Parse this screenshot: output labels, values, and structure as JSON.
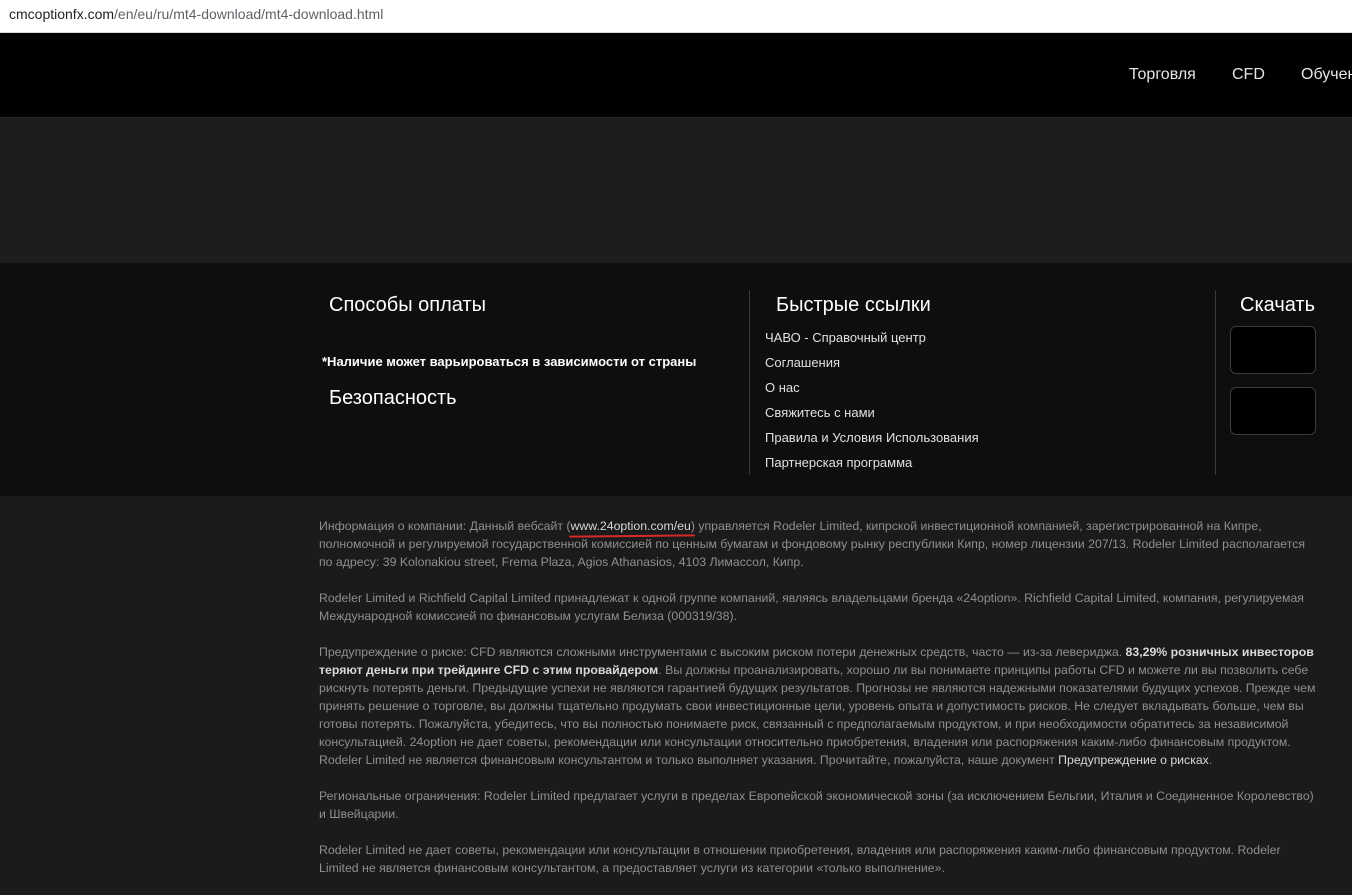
{
  "address_bar": {
    "host": "cmcoptionfx.com",
    "path": "/en/eu/ru/mt4-download/mt4-download.html"
  },
  "nav": {
    "items": [
      "Торговля",
      "CFD",
      "Обучение"
    ]
  },
  "footer": {
    "payment_title": "Способы оплаты",
    "availability_note": "*Наличие может варьироваться в зависимости от страны",
    "security_title": "Безопасность",
    "quick_links_title": "Быстрые ссылки",
    "quick_links": [
      "ЧАВО - Справочный центр",
      "Соглашения",
      "О нас",
      "Свяжитесь с нами",
      "Правила и Условия Использования",
      "Партнерская программа"
    ],
    "download_title": "Скачать"
  },
  "legal": {
    "p1_label": "Информация о компании: Данный вебсайт (",
    "p1_link": "www.24option.com/eu",
    "p1_rest": ") управляется Rodeler Limited, кипрской инвестиционной компанией, зарегистрированной на Кипре, полномочной и регулируемой государственной комиссией по ценным бумагам и фондовому рынку республики Кипр, номер лицензии 207/13. Rodeler Limited располагается по адресу: 39 Kolonakiou street, Frema Plaza, Agios Athanasios, 4103 Лимассол, Кипр.",
    "p2": "Rodeler Limited и Richfield Capital Limited принадлежат к одной группе компаний, являясь владельцами бренда «24option». Richfield Capital Limited, компания, регулируемая Международной комиссией по финансовым услугам Белиза (000319/38).",
    "p3_start": "Предупреждение о риске: CFD являются сложными инструментами с высоким риском потери денежных средств, часто — из-за левериджа. ",
    "p3_bold": "83,29% розничных инвесторов теряют деньги при трейдинге CFD с этим провайдером",
    "p3_rest": ". Вы должны проанализировать, хорошо ли вы понимаете принципы работы CFD и можете ли вы позволить себе рискнуть потерять деньги. Предыдущие успехи не являются гарантией будущих результатов. Прогнозы не являются надежными показателями будущих успехов. Прежде чем принять решение о торговле, вы должны тщательно продумать свои инвестиционные цели, уровень опыта и допустимость рисков. Не следует вкладывать больше, чем вы готовы потерять. Пожалуйста, убедитесь, что вы полностью понимаете риск, связанный с предполагаемым продуктом, и при необходимости обратитесь за независимой консультацией. 24option не дает советы, рекомендации или консультации относительно приобретения, владения или распоряжения каким-либо финансовым продуктом. Rodeler Limited не является финансовым консультантом и только выполняет указания. Прочитайте, пожалуйста, наше документ ",
    "p3_link": "Предупреждение о рисках",
    "p3_end": ".",
    "p4": "Региональные ограничения: Rodeler Limited предлагает услуги в пределах Европейской экономической зоны (за исключением Бельгии, Италия и Соединенное Королевство) и Швейцарии.",
    "p5": "Rodeler Limited не дает советы, рекомендации или консультации в отношении приобретения, владения или распоряжения каким-либо финансовым продуктом. Rodeler Limited не является финансовым консультантом, а предоставляет услуги из категории «только выполнение»."
  }
}
